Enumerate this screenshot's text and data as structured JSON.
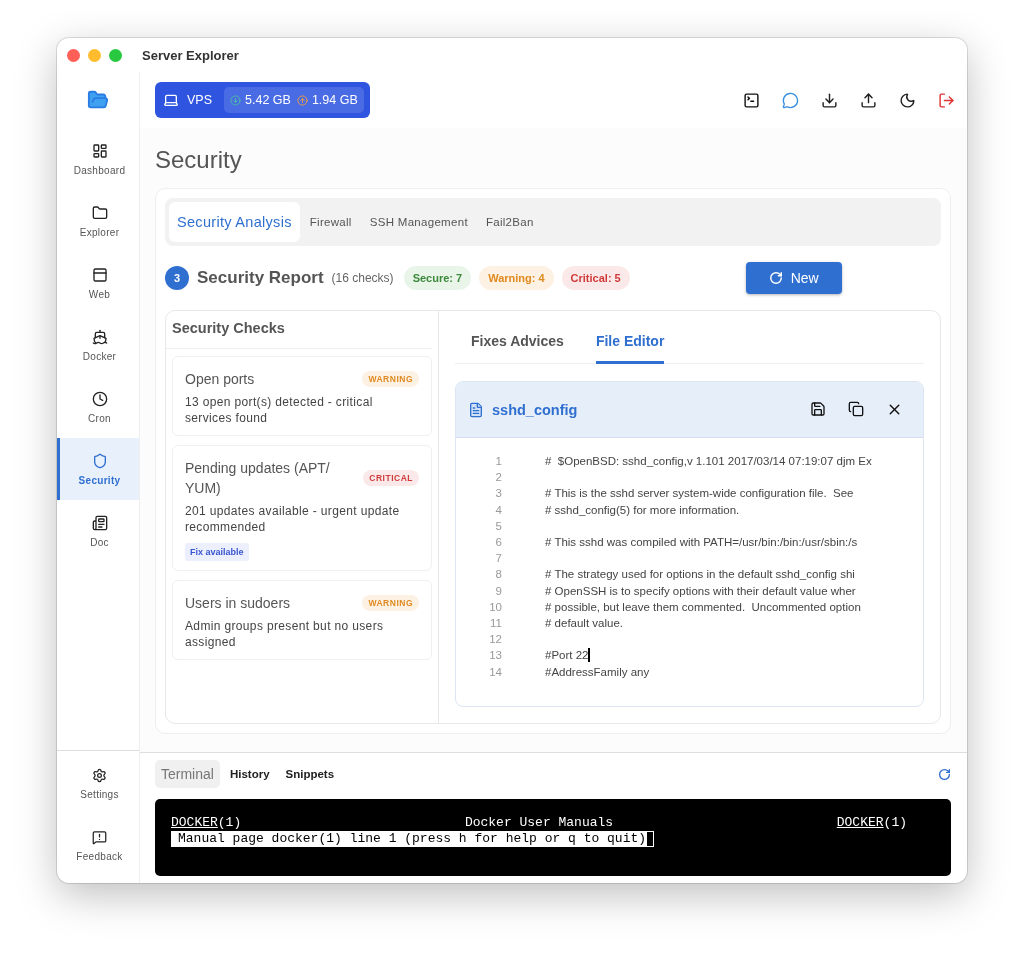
{
  "window": {
    "title": "Server Explorer"
  },
  "sidebar": {
    "items": [
      {
        "label": "Dashboard",
        "selected": false
      },
      {
        "label": "Explorer",
        "selected": false
      },
      {
        "label": "Web",
        "selected": false
      },
      {
        "label": "Docker",
        "selected": false
      },
      {
        "label": "Cron",
        "selected": false
      },
      {
        "label": "Security",
        "selected": true
      },
      {
        "label": "Doc",
        "selected": false
      }
    ],
    "footer_items": [
      "Settings",
      "Feedback"
    ]
  },
  "connection": {
    "name": "VPS",
    "download": "5.42 GB",
    "upload": "1.94 GB"
  },
  "page_title": "Security",
  "tabs": [
    {
      "label": "Security Analysis",
      "selected": true
    },
    {
      "label": "Firewall",
      "selected": false
    },
    {
      "label": "SSH Management",
      "selected": false
    },
    {
      "label": "Fail2Ban",
      "selected": false
    }
  ],
  "report": {
    "step": "3",
    "title": "Security Report",
    "count": "(16 checks)",
    "badges": [
      {
        "label": "Secure: 7",
        "kind": "secure"
      },
      {
        "label": "Warning: 4",
        "kind": "warning"
      },
      {
        "label": "Critical: 5",
        "kind": "critical"
      }
    ],
    "button": "New"
  },
  "checks": {
    "title": "Security Checks",
    "items": [
      {
        "title": "Open ports",
        "status": "WARNING",
        "kind": "warning",
        "description": "13 open port(s) detected - critical services found"
      },
      {
        "title": "Pending updates (APT/ YUM)",
        "status": "CRITICAL",
        "kind": "critical",
        "description": "201 updates available - urgent update recommended",
        "fix": "Fix available"
      },
      {
        "title": "Users in sudoers",
        "status": "WARNING",
        "kind": "warning",
        "description": "Admin groups present but no users assigned"
      }
    ]
  },
  "editor": {
    "tabs": [
      {
        "label": "Fixes Advices",
        "selected": false
      },
      {
        "label": "File Editor",
        "selected": true
      }
    ],
    "file_name": "sshd_config",
    "lines": [
      {
        "number": "1",
        "text": "#  $OpenBSD: sshd_config,v 1.101 2017/03/14 07:19:07 djm Ex",
        "cursor": false
      },
      {
        "number": "2",
        "cursor": false
      },
      {
        "number": "3",
        "text": "# This is the sshd server system-wide configuration file.  See",
        "cursor": false
      },
      {
        "number": "4",
        "text": "# sshd_config(5) for more information.",
        "cursor": false
      },
      {
        "number": "5",
        "cursor": false
      },
      {
        "number": "6",
        "text": "# This sshd was compiled with PATH=/usr/bin:/bin:/usr/sbin:/s",
        "cursor": false
      },
      {
        "number": "7",
        "cursor": false
      },
      {
        "number": "8",
        "text": "# The strategy used for options in the default sshd_config shi",
        "cursor": false
      },
      {
        "number": "9",
        "text": "# OpenSSH is to specify options with their default value wher",
        "cursor": false
      },
      {
        "number": "10",
        "text": "# possible, but leave them commented.  Uncommented option",
        "cursor": false
      },
      {
        "number": "11",
        "text": "# default value.",
        "cursor": false
      },
      {
        "number": "12",
        "cursor": false
      },
      {
        "number": "13",
        "text": "#Port 22",
        "cursor": true
      },
      {
        "number": "14",
        "text": "#AddressFamily any",
        "cursor": false
      }
    ]
  },
  "terminal": {
    "tabs": [
      {
        "label": "Terminal",
        "selected": true
      },
      {
        "label": "History",
        "selected": false
      },
      {
        "label": "Snippets",
        "selected": false
      }
    ],
    "header": {
      "left": {
        "name": "DOCKER",
        "section": "(1)"
      },
      "center": "Docker User Manuals",
      "right": {
        "name": "DOCKER",
        "section": "(1)"
      }
    },
    "status_line": "Manual page docker(1) line 1 (press h for help or q to quit)"
  }
}
